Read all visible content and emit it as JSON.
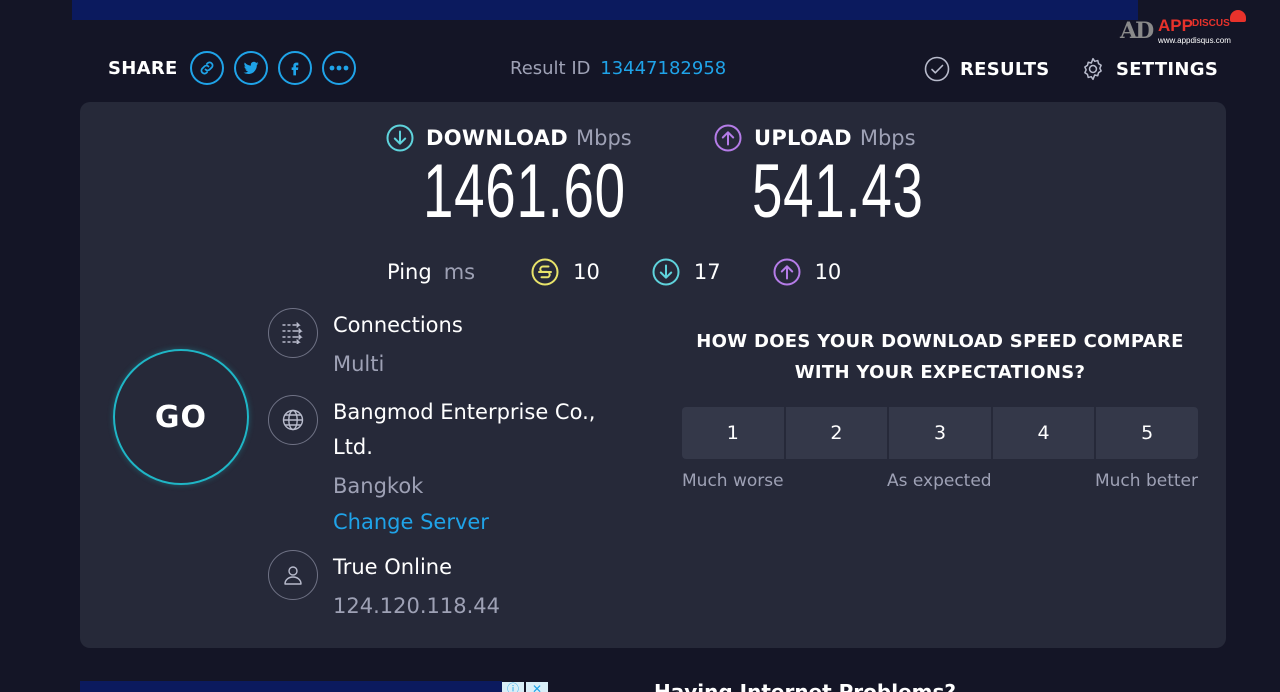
{
  "brand": {
    "ad": "AD",
    "app": "APP",
    "tag": "DISCUS",
    "url": "www.appdisqus.com"
  },
  "header": {
    "share_label": "SHARE",
    "result_id_label": "Result ID",
    "result_id": "13447182958",
    "results_label": "RESULTS",
    "settings_label": "SETTINGS"
  },
  "download": {
    "label": "DOWNLOAD",
    "unit": "Mbps",
    "value": "1461.60"
  },
  "upload": {
    "label": "UPLOAD",
    "unit": "Mbps",
    "value": "541.43"
  },
  "ping": {
    "label": "Ping",
    "unit": "ms",
    "idle": "10",
    "download": "17",
    "upload": "10"
  },
  "go_label": "GO",
  "connections": {
    "title": "Connections",
    "value": "Multi"
  },
  "server": {
    "name": "Bangmod Enterprise Co., Ltd.",
    "location": "Bangkok",
    "change": "Change Server"
  },
  "isp": {
    "name": "True Online",
    "ip": "124.120.118.44"
  },
  "survey": {
    "question": "HOW DOES YOUR DOWNLOAD SPEED COMPARE WITH YOUR EXPECTATIONS?",
    "options": [
      "1",
      "2",
      "3",
      "4",
      "5"
    ],
    "low_label": "Much worse",
    "mid_label": "As expected",
    "high_label": "Much better"
  },
  "bottom_heading": "Having Internet Problems?",
  "colors": {
    "background": "#141526",
    "panel": "#262939",
    "accent_blue": "#1fa3e8",
    "download_cyan": "#5fd3dc",
    "upload_purple": "#b57ce8",
    "ping_yellow": "#e8e36a",
    "go_ring": "#1fb6c6"
  }
}
